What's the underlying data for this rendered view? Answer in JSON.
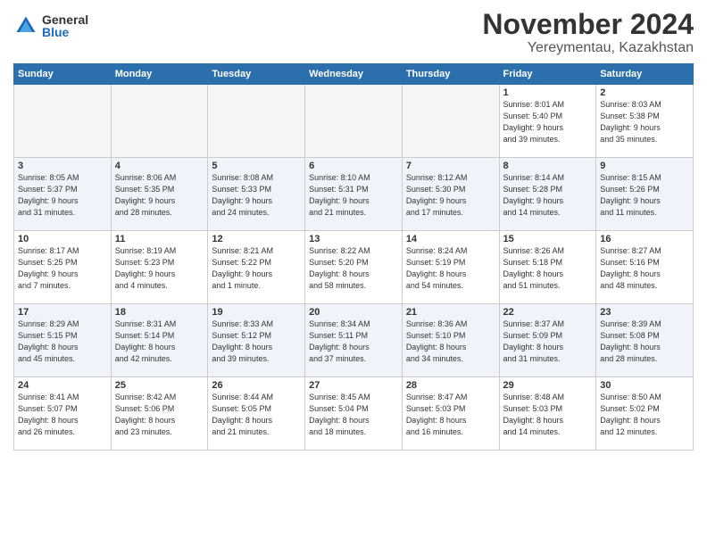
{
  "logo": {
    "general": "General",
    "blue": "Blue"
  },
  "header": {
    "month": "November 2024",
    "location": "Yereymentau, Kazakhstan"
  },
  "weekdays": [
    "Sunday",
    "Monday",
    "Tuesday",
    "Wednesday",
    "Thursday",
    "Friday",
    "Saturday"
  ],
  "weeks": [
    [
      {
        "day": "",
        "info": "",
        "empty": true
      },
      {
        "day": "",
        "info": "",
        "empty": true
      },
      {
        "day": "",
        "info": "",
        "empty": true
      },
      {
        "day": "",
        "info": "",
        "empty": true
      },
      {
        "day": "",
        "info": "",
        "empty": true
      },
      {
        "day": "1",
        "info": "Sunrise: 8:01 AM\nSunset: 5:40 PM\nDaylight: 9 hours\nand 39 minutes."
      },
      {
        "day": "2",
        "info": "Sunrise: 8:03 AM\nSunset: 5:38 PM\nDaylight: 9 hours\nand 35 minutes."
      }
    ],
    [
      {
        "day": "3",
        "info": "Sunrise: 8:05 AM\nSunset: 5:37 PM\nDaylight: 9 hours\nand 31 minutes."
      },
      {
        "day": "4",
        "info": "Sunrise: 8:06 AM\nSunset: 5:35 PM\nDaylight: 9 hours\nand 28 minutes."
      },
      {
        "day": "5",
        "info": "Sunrise: 8:08 AM\nSunset: 5:33 PM\nDaylight: 9 hours\nand 24 minutes."
      },
      {
        "day": "6",
        "info": "Sunrise: 8:10 AM\nSunset: 5:31 PM\nDaylight: 9 hours\nand 21 minutes."
      },
      {
        "day": "7",
        "info": "Sunrise: 8:12 AM\nSunset: 5:30 PM\nDaylight: 9 hours\nand 17 minutes."
      },
      {
        "day": "8",
        "info": "Sunrise: 8:14 AM\nSunset: 5:28 PM\nDaylight: 9 hours\nand 14 minutes."
      },
      {
        "day": "9",
        "info": "Sunrise: 8:15 AM\nSunset: 5:26 PM\nDaylight: 9 hours\nand 11 minutes."
      }
    ],
    [
      {
        "day": "10",
        "info": "Sunrise: 8:17 AM\nSunset: 5:25 PM\nDaylight: 9 hours\nand 7 minutes."
      },
      {
        "day": "11",
        "info": "Sunrise: 8:19 AM\nSunset: 5:23 PM\nDaylight: 9 hours\nand 4 minutes."
      },
      {
        "day": "12",
        "info": "Sunrise: 8:21 AM\nSunset: 5:22 PM\nDaylight: 9 hours\nand 1 minute."
      },
      {
        "day": "13",
        "info": "Sunrise: 8:22 AM\nSunset: 5:20 PM\nDaylight: 8 hours\nand 58 minutes."
      },
      {
        "day": "14",
        "info": "Sunrise: 8:24 AM\nSunset: 5:19 PM\nDaylight: 8 hours\nand 54 minutes."
      },
      {
        "day": "15",
        "info": "Sunrise: 8:26 AM\nSunset: 5:18 PM\nDaylight: 8 hours\nand 51 minutes."
      },
      {
        "day": "16",
        "info": "Sunrise: 8:27 AM\nSunset: 5:16 PM\nDaylight: 8 hours\nand 48 minutes."
      }
    ],
    [
      {
        "day": "17",
        "info": "Sunrise: 8:29 AM\nSunset: 5:15 PM\nDaylight: 8 hours\nand 45 minutes."
      },
      {
        "day": "18",
        "info": "Sunrise: 8:31 AM\nSunset: 5:14 PM\nDaylight: 8 hours\nand 42 minutes."
      },
      {
        "day": "19",
        "info": "Sunrise: 8:33 AM\nSunset: 5:12 PM\nDaylight: 8 hours\nand 39 minutes."
      },
      {
        "day": "20",
        "info": "Sunrise: 8:34 AM\nSunset: 5:11 PM\nDaylight: 8 hours\nand 37 minutes."
      },
      {
        "day": "21",
        "info": "Sunrise: 8:36 AM\nSunset: 5:10 PM\nDaylight: 8 hours\nand 34 minutes."
      },
      {
        "day": "22",
        "info": "Sunrise: 8:37 AM\nSunset: 5:09 PM\nDaylight: 8 hours\nand 31 minutes."
      },
      {
        "day": "23",
        "info": "Sunrise: 8:39 AM\nSunset: 5:08 PM\nDaylight: 8 hours\nand 28 minutes."
      }
    ],
    [
      {
        "day": "24",
        "info": "Sunrise: 8:41 AM\nSunset: 5:07 PM\nDaylight: 8 hours\nand 26 minutes."
      },
      {
        "day": "25",
        "info": "Sunrise: 8:42 AM\nSunset: 5:06 PM\nDaylight: 8 hours\nand 23 minutes."
      },
      {
        "day": "26",
        "info": "Sunrise: 8:44 AM\nSunset: 5:05 PM\nDaylight: 8 hours\nand 21 minutes."
      },
      {
        "day": "27",
        "info": "Sunrise: 8:45 AM\nSunset: 5:04 PM\nDaylight: 8 hours\nand 18 minutes."
      },
      {
        "day": "28",
        "info": "Sunrise: 8:47 AM\nSunset: 5:03 PM\nDaylight: 8 hours\nand 16 minutes."
      },
      {
        "day": "29",
        "info": "Sunrise: 8:48 AM\nSunset: 5:03 PM\nDaylight: 8 hours\nand 14 minutes."
      },
      {
        "day": "30",
        "info": "Sunrise: 8:50 AM\nSunset: 5:02 PM\nDaylight: 8 hours\nand 12 minutes."
      }
    ]
  ]
}
